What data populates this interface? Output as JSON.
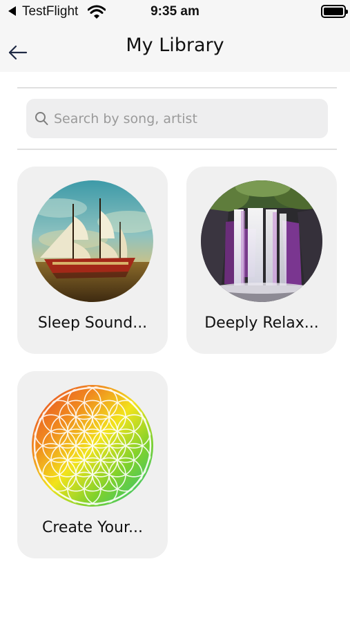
{
  "status_bar": {
    "app_label": "TestFlight",
    "time": "9:35 am"
  },
  "nav": {
    "title": "My Library",
    "back_icon": "arrow-left-icon"
  },
  "search": {
    "placeholder": "Search by song, artist",
    "value": "",
    "icon": "search-icon"
  },
  "library": {
    "items": [
      {
        "title": "Sleep Sound...",
        "artwork": "sailing-ship-artwork"
      },
      {
        "title": "Deeply Relax...",
        "artwork": "waterfall-artwork"
      },
      {
        "title": "Create Your...",
        "artwork": "flower-of-life-artwork"
      }
    ]
  },
  "colors": {
    "background": "#ffffff",
    "header_background": "#f6f6f6",
    "card_background": "#f0f0f0",
    "search_background": "#eeeeef",
    "divider": "#e0e0e0",
    "text": "#111111",
    "placeholder": "#9a9a9a"
  }
}
